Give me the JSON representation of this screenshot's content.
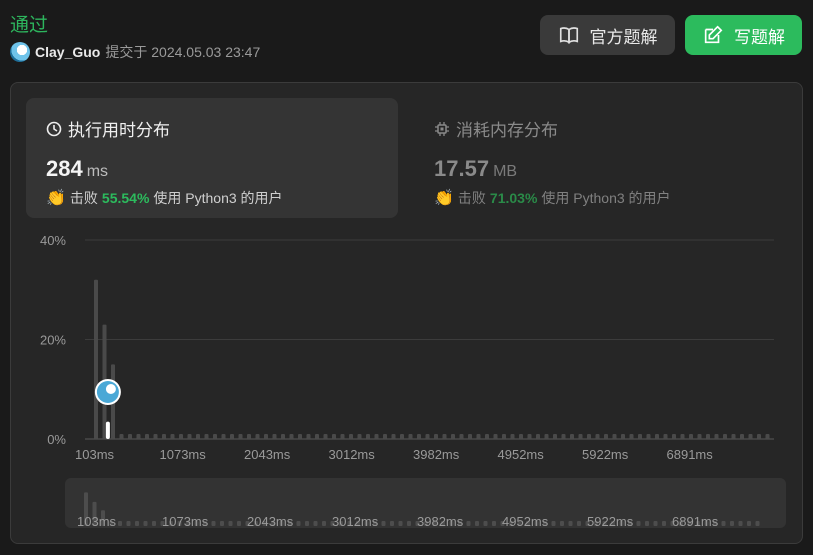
{
  "header": {
    "status": "通过",
    "username": "Clay_Guo",
    "submitted_at": "提交于 2024.05.03 23:47",
    "official_solution_label": "官方题解",
    "write_solution_label": "写题解"
  },
  "cards": {
    "runtime": {
      "title": "执行用时分布",
      "value": "284",
      "unit": "ms",
      "beats_label": "击败",
      "beats_pct": "55.54%",
      "beats_suffix": "使用 Python3 的用户"
    },
    "memory": {
      "title": "消耗内存分布",
      "value": "17.57",
      "unit": "MB",
      "beats_label": "击败",
      "beats_pct": "71.03%",
      "beats_suffix": "使用 Python3 的用户"
    }
  },
  "colors": {
    "accent": "#2cbb5d",
    "bar": "#4a4a4a",
    "highlight_bar": "#ffffff"
  },
  "chart_data": {
    "type": "bar",
    "x_tick_labels": [
      "103ms",
      "1073ms",
      "2043ms",
      "3012ms",
      "3982ms",
      "4952ms",
      "5922ms",
      "6891ms"
    ],
    "y_tick_labels": [
      "0%",
      "20%",
      "40%"
    ],
    "ylim": [
      0,
      40
    ],
    "bar_count": 80,
    "values": [
      32,
      23,
      15,
      1,
      1,
      1,
      1,
      1,
      1,
      1,
      1,
      1,
      1,
      1,
      1,
      1,
      1,
      1,
      1,
      1,
      1,
      1,
      1,
      1,
      1,
      1,
      1,
      1,
      1,
      1,
      1,
      1,
      1,
      1,
      1,
      1,
      1,
      1,
      1,
      1,
      1,
      1,
      1,
      1,
      1,
      1,
      1,
      1,
      1,
      1,
      1,
      1,
      1,
      1,
      1,
      1,
      1,
      1,
      1,
      1,
      1,
      1,
      1,
      1,
      1,
      1,
      1,
      1,
      1,
      1,
      1,
      1,
      1,
      1,
      1,
      1,
      1,
      1,
      1,
      1
    ],
    "highlight_value": 3.5,
    "grid": true
  }
}
